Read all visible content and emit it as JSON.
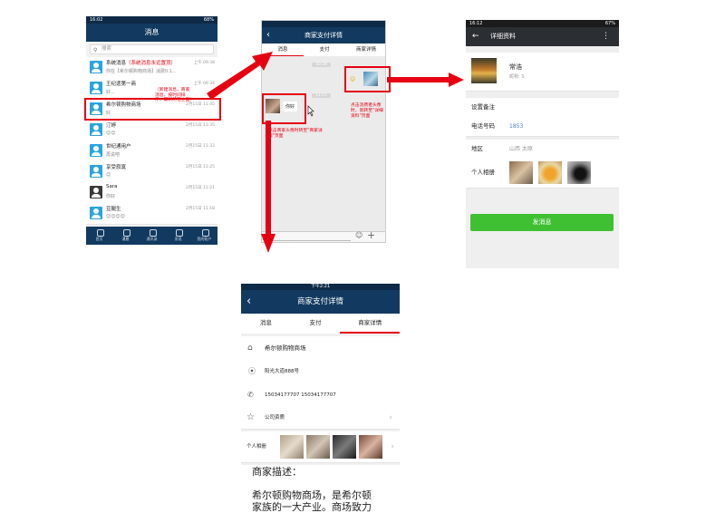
{
  "screen1": {
    "status_time": "16:02",
    "status_battery": "68%",
    "title": "消息",
    "search_placeholder": "搜索",
    "messages": [
      {
        "name": "系统消息",
        "highlight": "（系统消息永远置顶）",
        "preview": "你在【希尔顿购物商场】消费0.1...",
        "time": "上午 09:38"
      },
      {
        "name": "王纪遗第一商",
        "preview": "好...",
        "time": "上午 09:34"
      },
      {
        "name": "希尔顿购物商场",
        "preview": "好",
        "time": "2月15日 11:45"
      },
      {
        "name": "汀婷",
        "preview": "😊😊",
        "time": "2月15日 11:35"
      },
      {
        "name": "世纪通用户",
        "preview": "再说吧",
        "time": "2月15日 11:33"
      },
      {
        "name": "享受寂寞",
        "preview": "😊",
        "time": "2月15日 11:25"
      },
      {
        "name": "Sara",
        "preview": "你好",
        "time": "2月15日 11:21"
      },
      {
        "name": "豆腿生",
        "preview": "😊😊😊😊",
        "time": "2月15日 11:18"
      }
    ],
    "annotation": "（新建消息，商家消息，按时间排序，最新的在上面）",
    "tabs": [
      "首页",
      "消息",
      "通讯录",
      "发现",
      "我的账户"
    ]
  },
  "screen2": {
    "title": "商家支付详情",
    "tabs": [
      "消息",
      "支付",
      "商家详情"
    ],
    "time_labels": [
      "10:38",
      "11:15"
    ],
    "merchant_bubble": "你好",
    "note_right": "点击消费者头像时，就转至\"详细资料\"页面",
    "note_left": "点击商家头像时转至\"商家详情\"页面"
  },
  "screen3": {
    "status_time": "16:12",
    "status_battery": "67%",
    "title": "详细资料",
    "name": "常浩",
    "nickname": "昵称: S",
    "remark_label": "设置备注",
    "phone_label": "电话号码",
    "phone_value": "1853",
    "region_label": "地区",
    "region_value": "山西  太原",
    "album_label": "个人相册",
    "send_button": "发消息"
  },
  "screen4": {
    "status_time": "下午2:21",
    "title": "商家支付详情",
    "tabs": [
      "消息",
      "支付",
      "商家详情"
    ],
    "merchant_name": "希尔顿购物商场",
    "address": "阳光大道888号",
    "phones": "15034177707  15034177707",
    "certificate_label": "公司资质",
    "album_label": "个人相册",
    "desc_title": "商家描述：",
    "desc_line1": "希尔顿购物商场，是希尔顿",
    "desc_line2": "家族的一大产业。商场致力"
  },
  "colors": {
    "header": "#123a60",
    "accent": "#e60012",
    "green": "#3fbf32",
    "avatar": "#2aa4e0"
  }
}
